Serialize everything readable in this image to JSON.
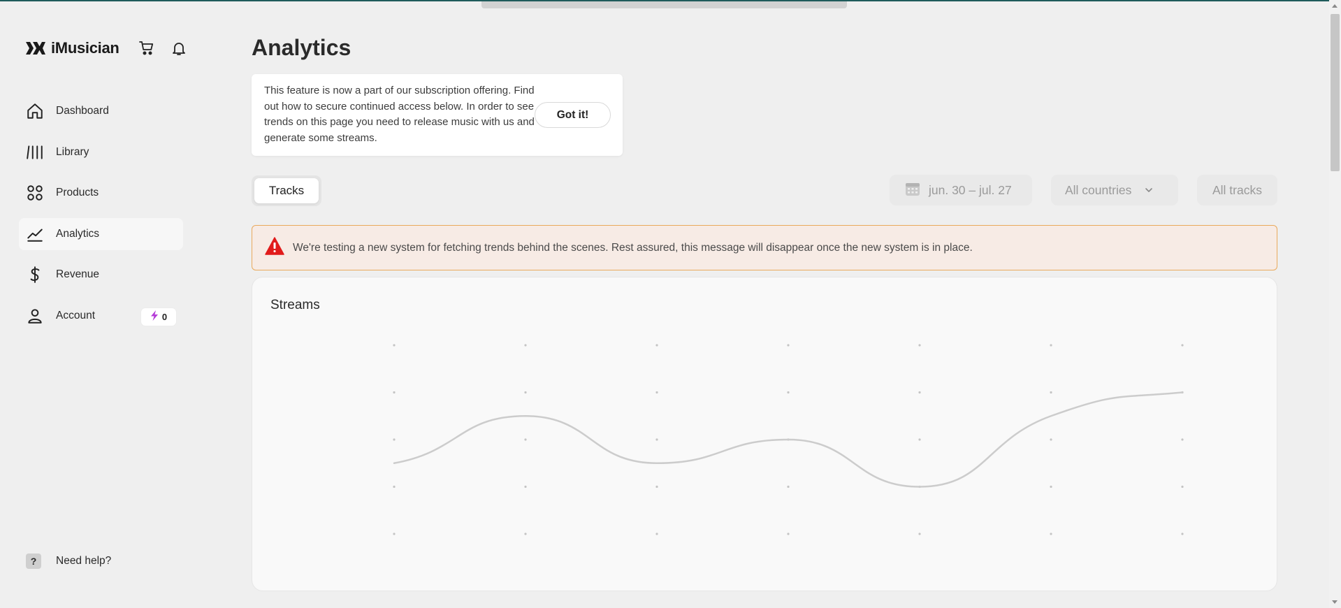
{
  "brand": {
    "name": "iMusician"
  },
  "header_icons": [
    "cart-icon",
    "bell-icon"
  ],
  "sidebar": {
    "items": [
      {
        "label": "Dashboard",
        "icon": "home-icon"
      },
      {
        "label": "Library",
        "icon": "library-icon"
      },
      {
        "label": "Products",
        "icon": "grid-icon"
      },
      {
        "label": "Analytics",
        "icon": "chart-line-icon",
        "active": true
      },
      {
        "label": "Revenue",
        "icon": "dollar-icon"
      },
      {
        "label": "Account",
        "icon": "user-icon",
        "badge": "0"
      }
    ],
    "help_label": "Need help?"
  },
  "page": {
    "title": "Analytics"
  },
  "notice": {
    "text": "This feature is now a part of our subscription offering. Find out how to secure continued access below. In order to see trends on this page you need to release music with us and generate some streams.",
    "button_label": "Got it!"
  },
  "tabs": {
    "tracks_label": "Tracks"
  },
  "filters": {
    "date_range": "jun. 30 – jul. 27",
    "countries": "All countries",
    "tracks": "All tracks"
  },
  "alert": {
    "text": "We're testing a new system for fetching trends behind the scenes. Rest assured, this message will disappear once the new system is in place.",
    "icon": "warning-icon",
    "color": "#e11b1b"
  },
  "colors": {
    "accent_border": "#e9a95c",
    "alert_bg": "#f7ebe5",
    "line": "#cccccc",
    "bolt": "#b53cd8"
  },
  "chart_data": {
    "type": "line",
    "title": "Streams",
    "xlabel": "",
    "ylabel": "",
    "grid": "dots",
    "series": [
      {
        "values": [
          1.5,
          2.5,
          1.5,
          2.0,
          1.0,
          2.5,
          3.0
        ]
      }
    ],
    "ylim": [
      0,
      4
    ]
  }
}
